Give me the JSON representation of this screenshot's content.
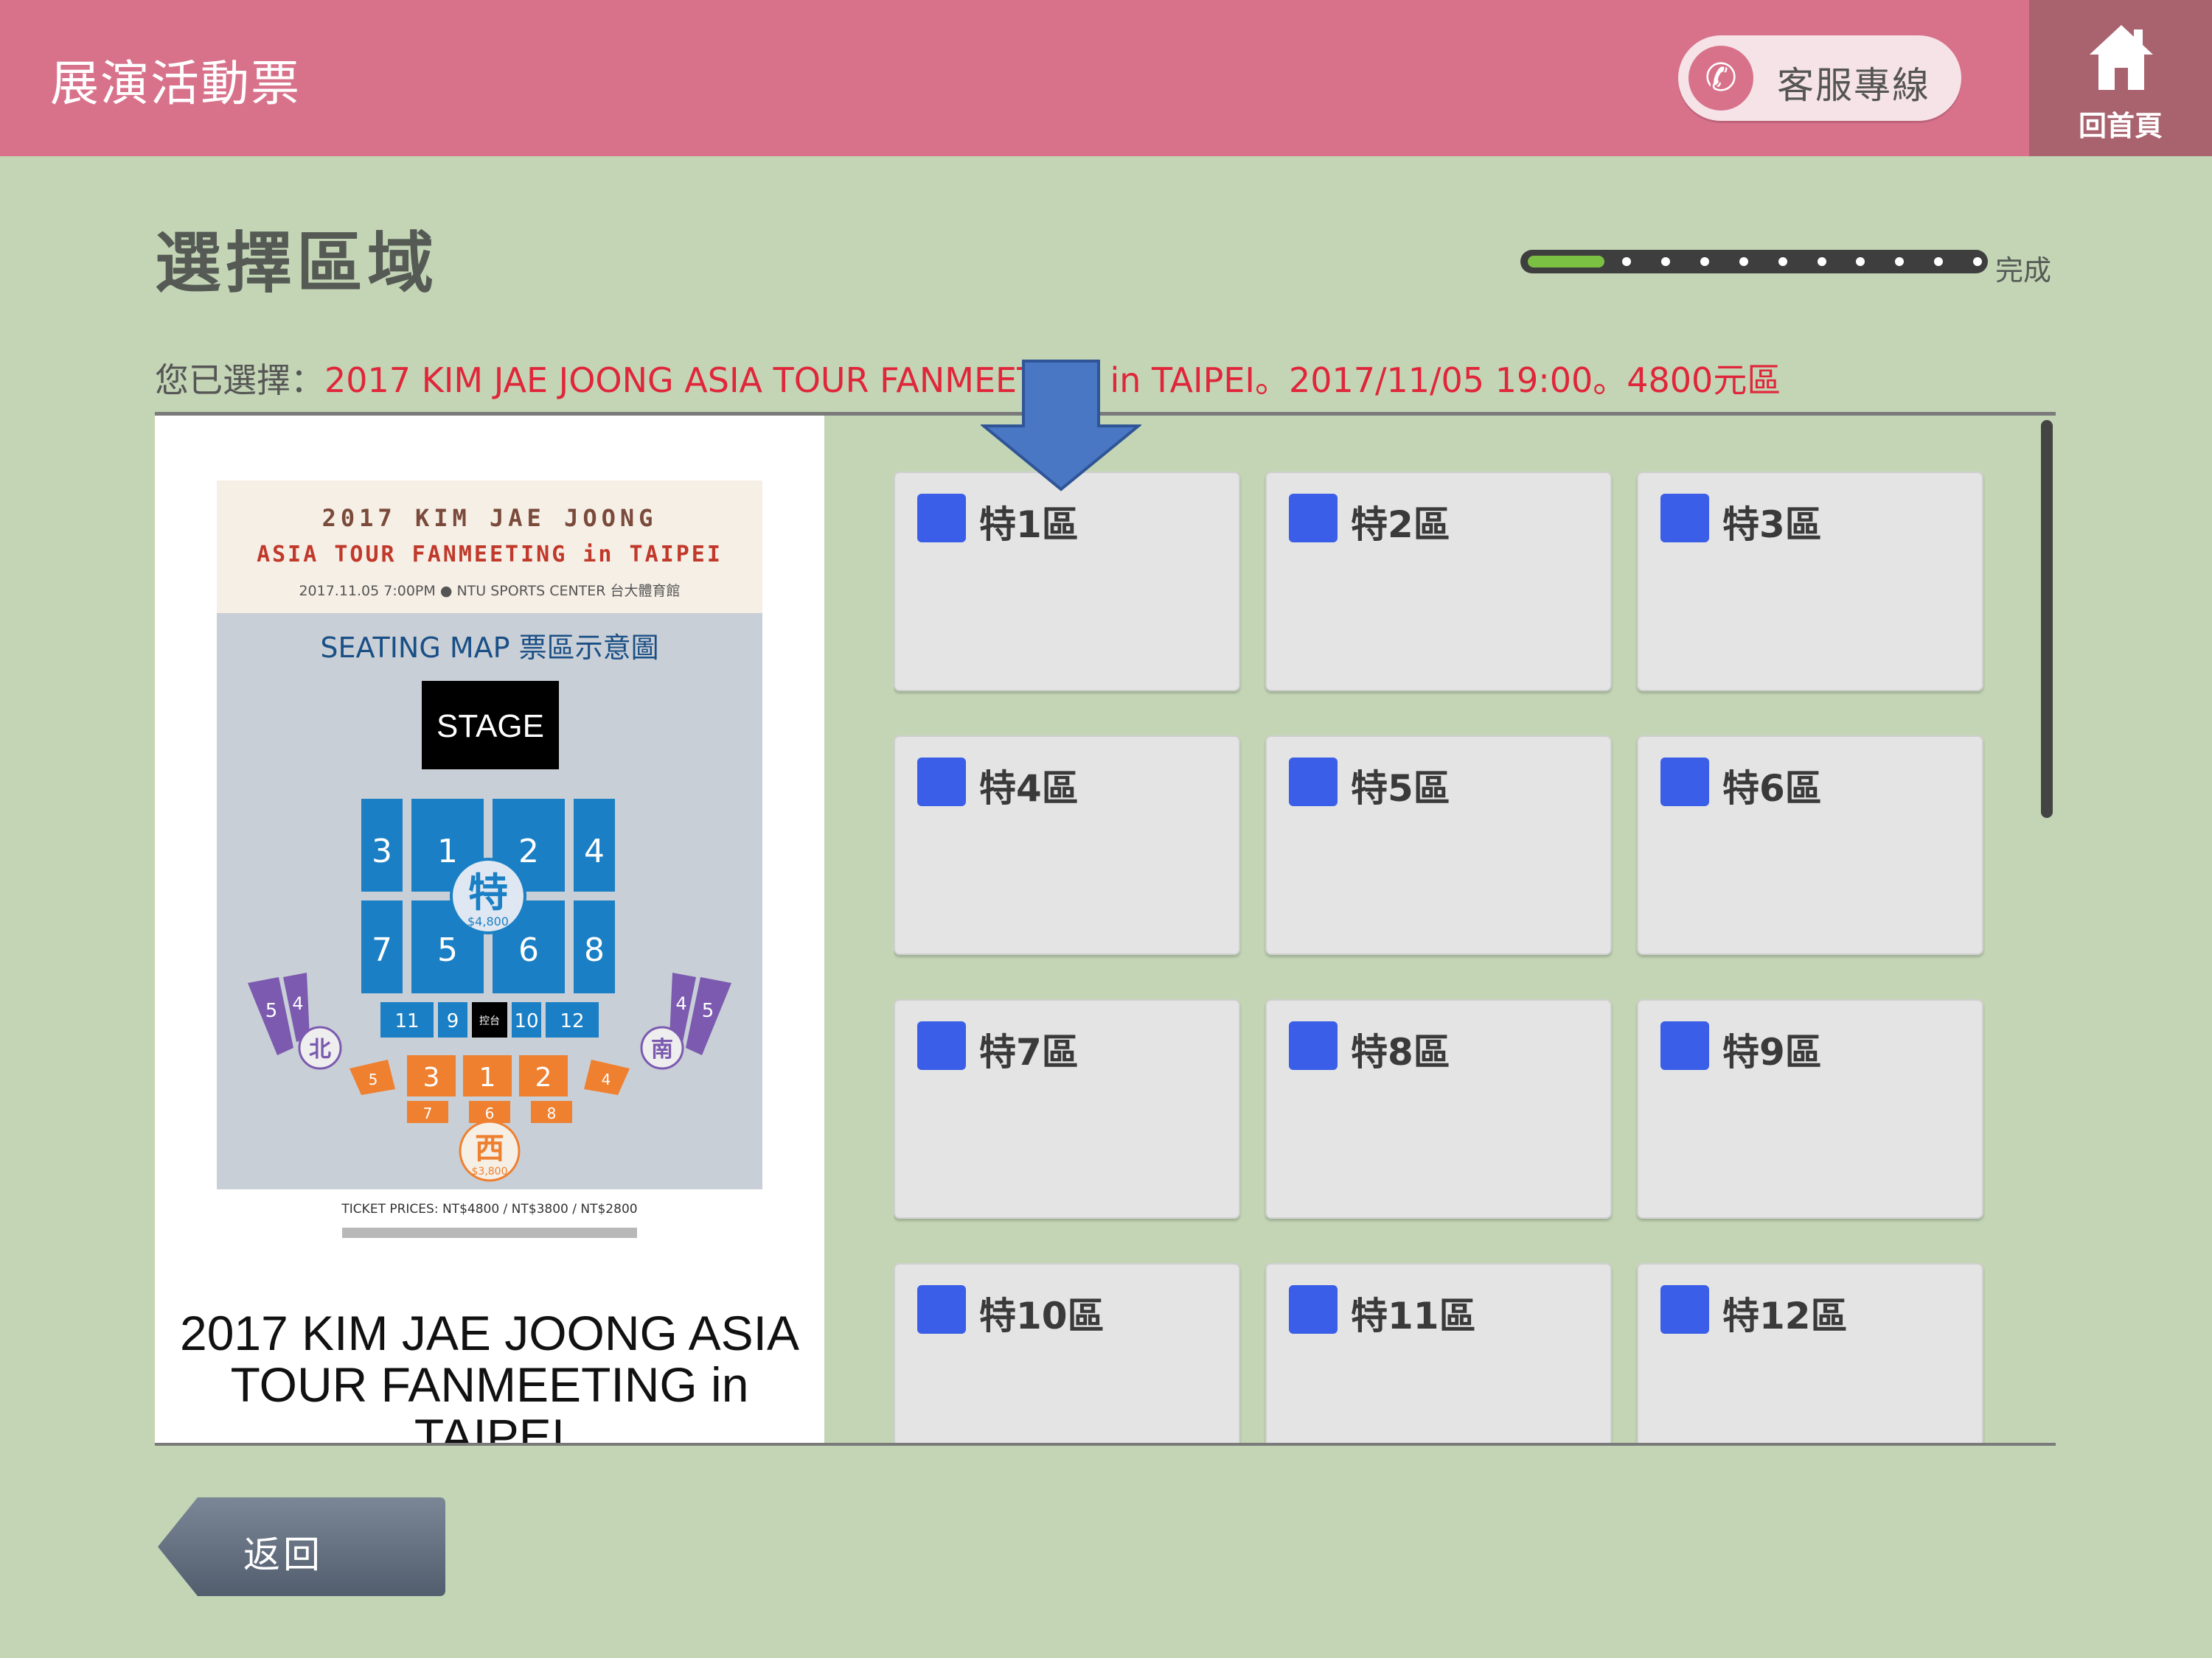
{
  "header": {
    "title": "展演活動票",
    "service_label": "客服專線",
    "home_label": "回首頁",
    "color": "#d8728b"
  },
  "main": {
    "title": "選擇區域",
    "progress": {
      "fraction": 0.17,
      "end_label": "完成",
      "dots": 10
    },
    "selection_prefix": "您已選擇：",
    "selection_value": "2017 KIM JAE JOONG ASIA TOUR FANMEETING in TAIPEI。2017/11/05 19:00。4800元區",
    "event_name": "2017 KIM JAE JOONG ASIA TOUR FANMEETING in TAIPEI",
    "back_label": "返回"
  },
  "poster": {
    "line1": "2017 KIM JAE JOONG",
    "line2": "ASIA TOUR FANMEETING in TAIPEI",
    "info": "2017.11.05 7:00PM ● NTU SPORTS CENTER 台大體育館",
    "map_title": "SEATING MAP 票區示意圖",
    "stage": "STAGE",
    "center_label": "特",
    "center_price": "$4,800",
    "blue_blocks": [
      "3",
      "1",
      "2",
      "4",
      "7",
      "5",
      "6",
      "8"
    ],
    "small_blocks": [
      "11",
      "9",
      "10",
      "12"
    ],
    "control_label": "控台",
    "north_label": "北",
    "south_label": "南",
    "west_label": "西",
    "west_price": "$3,800",
    "purple_numbers": [
      "5",
      "4",
      "4",
      "5"
    ],
    "orange_front": [
      "3",
      "1",
      "2"
    ],
    "orange_side": [
      "5",
      "4"
    ],
    "orange_back": [
      "7",
      "6",
      "8"
    ],
    "ticket_prices": "TICKET PRICES: NT$4800 / NT$3800 / NT$2800"
  },
  "zones": [
    {
      "label": "特1區"
    },
    {
      "label": "特2區"
    },
    {
      "label": "特3區"
    },
    {
      "label": "特4區"
    },
    {
      "label": "特5區"
    },
    {
      "label": "特6區"
    },
    {
      "label": "特7區"
    },
    {
      "label": "特8區"
    },
    {
      "label": "特9區"
    },
    {
      "label": "特10區"
    },
    {
      "label": "特11區"
    },
    {
      "label": "特12區"
    }
  ],
  "icons": [
    "phone-icon",
    "home-icon",
    "down-arrow-icon"
  ],
  "colors": {
    "accent": "#d8728b",
    "zone_swatch": "#3a5ee8",
    "selection_text": "#e0263a",
    "progress": "#7bc043"
  }
}
